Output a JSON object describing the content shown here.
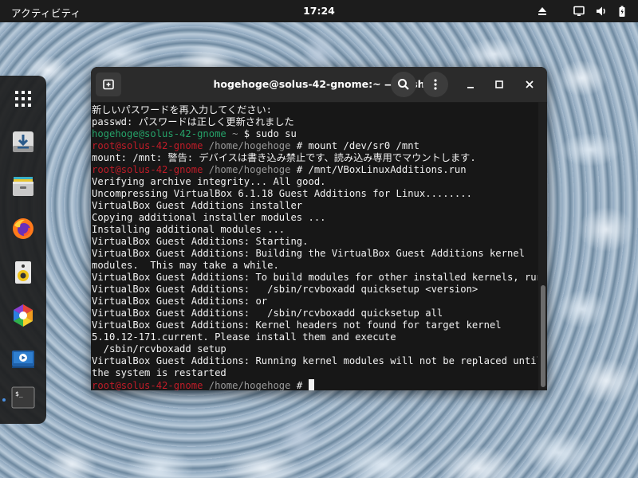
{
  "topbar": {
    "activities_label": "アクティビティ",
    "clock": "17:24",
    "tray": {
      "eject_icon": "eject-icon",
      "display_icon": "display-icon",
      "battery_icon": "battery-icon"
    }
  },
  "dock": {
    "items": [
      {
        "name": "app-grid",
        "icon": "app-grid-icon"
      },
      {
        "name": "software-install",
        "icon": "download-icon"
      },
      {
        "name": "files",
        "icon": "file-cabinet-icon"
      },
      {
        "name": "firefox",
        "icon": "firefox-icon"
      },
      {
        "name": "rhythmbox",
        "icon": "speaker-icon"
      },
      {
        "name": "gnome-software",
        "icon": "hexagon-icon"
      },
      {
        "name": "screen-recorder",
        "icon": "video-player-icon"
      },
      {
        "name": "terminal",
        "icon": "terminal-icon",
        "running": true
      }
    ]
  },
  "terminal": {
    "title": "hogehoge@solus-42-gnome:~ — bash",
    "lines": [
      {
        "type": "text",
        "text": "新しいパスワードを再入力してください:"
      },
      {
        "type": "text",
        "text": "passwd: パスワードは正しく更新されました"
      },
      {
        "type": "user_prompt",
        "user": "hogehoge",
        "host": "@solus-42-gnome",
        "path": " ~",
        "sym": " $ ",
        "cmd": "sudo su"
      },
      {
        "type": "root_prompt",
        "user": "root",
        "host": "@solus-42-gnome",
        "path": " /home/hogehoge",
        "sym": " # ",
        "cmd": "mount /dev/sr0 /mnt"
      },
      {
        "type": "text",
        "text": "mount: /mnt: 警告: デバイスは書き込み禁止です、読み込み専用でマウントします."
      },
      {
        "type": "root_prompt",
        "user": "root",
        "host": "@solus-42-gnome",
        "path": " /home/hogehoge",
        "sym": " # ",
        "cmd": "/mnt/VBoxLinuxAdditions.run"
      },
      {
        "type": "text",
        "text": "Verifying archive integrity... All good."
      },
      {
        "type": "text",
        "text": "Uncompressing VirtualBox 6.1.18 Guest Additions for Linux........"
      },
      {
        "type": "text",
        "text": "VirtualBox Guest Additions installer"
      },
      {
        "type": "text",
        "text": "Copying additional installer modules ..."
      },
      {
        "type": "text",
        "text": "Installing additional modules ..."
      },
      {
        "type": "text",
        "text": "VirtualBox Guest Additions: Starting."
      },
      {
        "type": "text",
        "text": "VirtualBox Guest Additions: Building the VirtualBox Guest Additions kernel"
      },
      {
        "type": "text",
        "text": "modules.  This may take a while."
      },
      {
        "type": "text",
        "text": "VirtualBox Guest Additions: To build modules for other installed kernels, run"
      },
      {
        "type": "text",
        "text": "VirtualBox Guest Additions:   /sbin/rcvboxadd quicksetup <version>"
      },
      {
        "type": "text",
        "text": "VirtualBox Guest Additions: or"
      },
      {
        "type": "text",
        "text": "VirtualBox Guest Additions:   /sbin/rcvboxadd quicksetup all"
      },
      {
        "type": "text",
        "text": "VirtualBox Guest Additions: Kernel headers not found for target kernel"
      },
      {
        "type": "text",
        "text": "5.10.12-171.current. Please install them and execute"
      },
      {
        "type": "text",
        "text": "  /sbin/rcvboxadd setup"
      },
      {
        "type": "text",
        "text": "VirtualBox Guest Additions: Running kernel modules will not be replaced until"
      },
      {
        "type": "text",
        "text": "the system is restarted"
      },
      {
        "type": "root_prompt",
        "user": "root",
        "host": "@solus-42-gnome",
        "path": " /home/hogehoge",
        "sym": " # ",
        "cmd": "",
        "cursor": true
      }
    ]
  },
  "colors": {
    "user_prompt": "#26a269",
    "root_prompt": "#c01c28",
    "path": "#9a9a9a",
    "terminal_bg": "#171717",
    "titlebar_bg": "#2b2b2b",
    "topbar_bg": "#1c1c1c"
  }
}
